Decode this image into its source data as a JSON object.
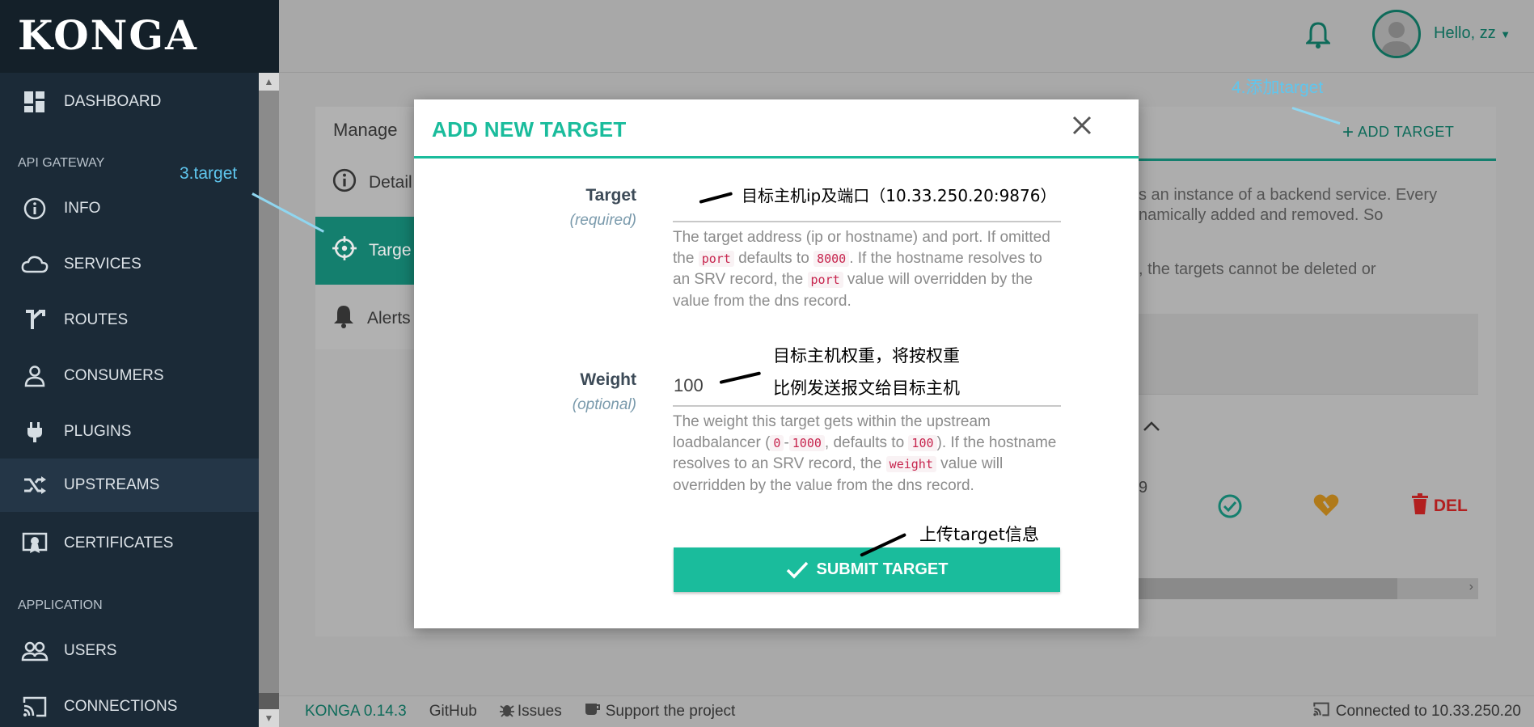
{
  "app": {
    "logo": "KONGA"
  },
  "sidebar": {
    "items": [
      {
        "label": "DASHBOARD",
        "icon": "dashboard-icon"
      },
      {
        "label": "INFO",
        "icon": "info-icon"
      },
      {
        "label": "SERVICES",
        "icon": "cloud-icon"
      },
      {
        "label": "ROUTES",
        "icon": "routes-icon"
      },
      {
        "label": "CONSUMERS",
        "icon": "user-icon"
      },
      {
        "label": "PLUGINS",
        "icon": "plug-icon"
      },
      {
        "label": "UPSTREAMS",
        "icon": "shuffle-icon"
      },
      {
        "label": "CERTIFICATES",
        "icon": "certificate-icon"
      },
      {
        "label": "USERS",
        "icon": "users-icon"
      },
      {
        "label": "CONNECTIONS",
        "icon": "cast-icon"
      }
    ],
    "sections": {
      "api_gateway": "API GATEWAY",
      "application": "APPLICATION"
    },
    "active": "UPSTREAMS"
  },
  "header": {
    "greeting": "Hello, zz"
  },
  "background": {
    "manage_title": "Manage",
    "tabs": [
      {
        "label": "Detail",
        "icon": "info-icon"
      },
      {
        "label": "Targe",
        "icon": "crosshair-icon"
      },
      {
        "label": "Alerts",
        "icon": "bell-icon"
      }
    ],
    "add_target_label": "ADD TARGET",
    "description_lines": [
      "s an instance of a backend service. Every",
      "namically added and removed. So",
      ", the targets cannot be deleted or"
    ],
    "row_partial_value": "9",
    "delete_label": "DEL"
  },
  "modal": {
    "title": "ADD NEW TARGET",
    "target": {
      "label": "Target",
      "sublabel": "(required)",
      "value": "",
      "help_parts": [
        "The target address (ip or hostname) and port. If omitted the ",
        "port",
        " defaults to ",
        "8000",
        ". If the hostname resolves to an SRV record, the ",
        "port",
        " value will overridden by the value from the dns record."
      ]
    },
    "weight": {
      "label": "Weight",
      "sublabel": "(optional)",
      "value": "100",
      "help_parts": [
        "The weight this target gets within the upstream loadbalancer (",
        "0",
        "-",
        "1000",
        ", defaults to ",
        "100",
        "). If the hostname resolves to an SRV record, the ",
        "weight",
        " value will overridden by the value from the dns record."
      ]
    },
    "submit_label": "SUBMIT TARGET"
  },
  "annotations": {
    "step3": "3.target",
    "step4": "4.添加target",
    "target_note": "目标主机ip及端口（10.33.250.20:9876）",
    "weight_note_1": "目标主机权重，将按权重",
    "weight_note_2": "比例发送报文给目标主机",
    "submit_note": "上传target信息"
  },
  "footer": {
    "version": "KONGA 0.14.3",
    "github": "GitHub",
    "issues": "Issues",
    "support": "Support the project",
    "connection": "Connected to 10.33.250.20"
  },
  "colors": {
    "accent": "#1abc9c",
    "sidebar": "#1b2a37",
    "danger": "#b21f1f"
  }
}
